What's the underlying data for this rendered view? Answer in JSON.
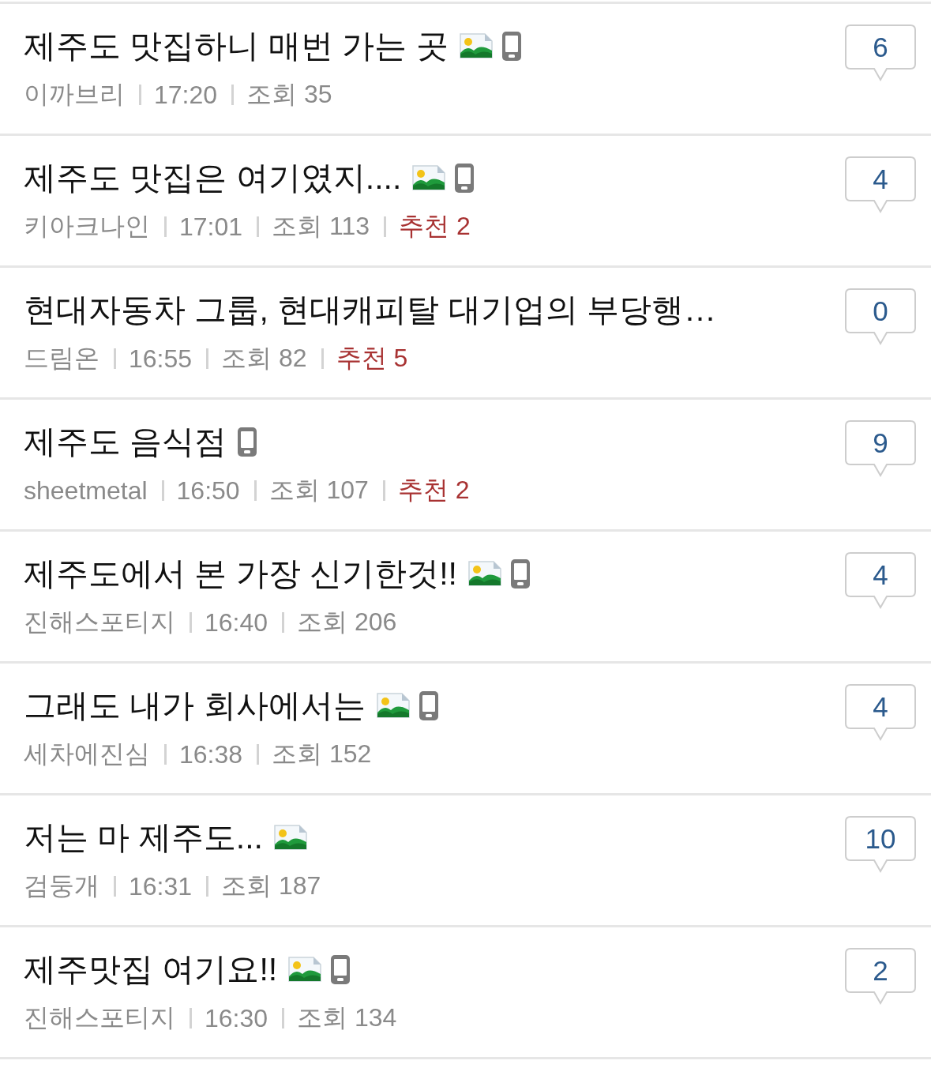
{
  "posts": [
    {
      "title": "제주도 맛집하니 매번 가는 곳",
      "has_image": true,
      "from_mobile": true,
      "author": "이까브리",
      "time": "17:20",
      "views": "조회 35",
      "comments": "6"
    },
    {
      "title": "제주도 맛집은 여기였지....",
      "has_image": true,
      "from_mobile": true,
      "author": "키아크나인",
      "time": "17:01",
      "views": "조회 113",
      "recommends": "추천 2",
      "comments": "4"
    },
    {
      "title": "현대자동차 그룹, 현대캐피탈 대기업의 부당행…",
      "has_image": false,
      "from_mobile": false,
      "author": "드림온",
      "time": "16:55",
      "views": "조회 82",
      "recommends": "추천 5",
      "comments": "0"
    },
    {
      "title": "제주도 음식점",
      "has_image": false,
      "from_mobile": true,
      "author": "sheetmetal",
      "time": "16:50",
      "views": "조회 107",
      "recommends": "추천 2",
      "comments": "9"
    },
    {
      "title": "제주도에서 본 가장 신기한것!!",
      "has_image": true,
      "from_mobile": true,
      "author": "진해스포티지",
      "time": "16:40",
      "views": "조회 206",
      "comments": "4"
    },
    {
      "title": "그래도 내가 회사에서는",
      "has_image": true,
      "from_mobile": true,
      "author": "세차에진심",
      "time": "16:38",
      "views": "조회 152",
      "comments": "4"
    },
    {
      "title": "저는 마 제주도...",
      "has_image": true,
      "from_mobile": false,
      "author": "검둥개",
      "time": "16:31",
      "views": "조회 187",
      "comments": "10"
    },
    {
      "title": "제주맛집 여기요!!",
      "has_image": true,
      "from_mobile": true,
      "author": "진해스포티지",
      "time": "16:30",
      "views": "조회 134",
      "comments": "2"
    }
  ]
}
